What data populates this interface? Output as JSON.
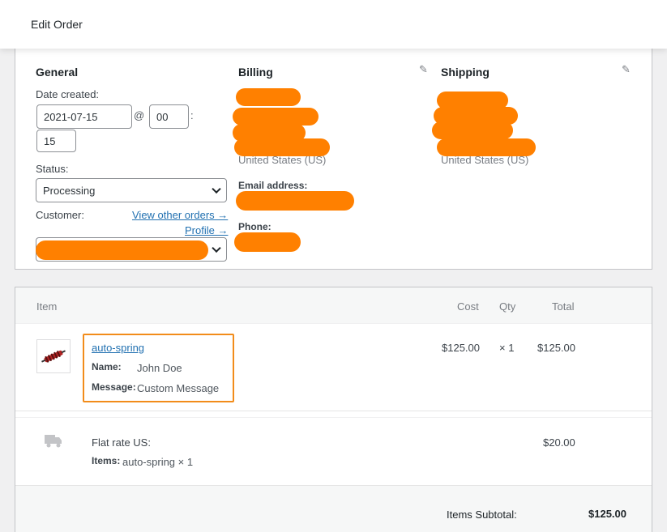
{
  "header": {
    "title": "Edit Order"
  },
  "general": {
    "heading": "General",
    "date_created_label": "Date created:",
    "date_value": "2021-07-15",
    "at_sign": "@",
    "hour_value": "00",
    "colon": ":",
    "minute_value": "15",
    "status_label": "Status:",
    "status_value": "Processing",
    "customer_label": "Customer:",
    "view_other_orders": "View other orders →",
    "profile_link": "Profile →"
  },
  "billing": {
    "heading": "Billing",
    "country": "United States (US)",
    "email_label": "Email address:",
    "phone_label": "Phone:"
  },
  "shipping": {
    "heading": "Shipping",
    "country": "United States (US)"
  },
  "items": {
    "columns": {
      "item": "Item",
      "cost": "Cost",
      "qty": "Qty",
      "total": "Total"
    },
    "line": {
      "name": "auto-spring",
      "meta": [
        {
          "key": "Name:",
          "value": "John Doe"
        },
        {
          "key": "Message:",
          "value": "Custom Message"
        }
      ],
      "cost": "$125.00",
      "qty": "× 1",
      "total": "$125.00"
    },
    "shipping_line": {
      "name": "Flat rate US:",
      "items_label": "Items:",
      "items_value": "auto-spring × 1",
      "total": "$20.00"
    },
    "subtotal_label": "Items Subtotal:",
    "subtotal_value": "$125.00"
  },
  "colors": {
    "redaction": "#ff8000",
    "highlight_border": "#f28c1a",
    "link": "#2271b1"
  },
  "icons": {
    "edit": "pencil-icon",
    "shipping": "truck-icon",
    "dropdown": "chevron-down-icon"
  }
}
